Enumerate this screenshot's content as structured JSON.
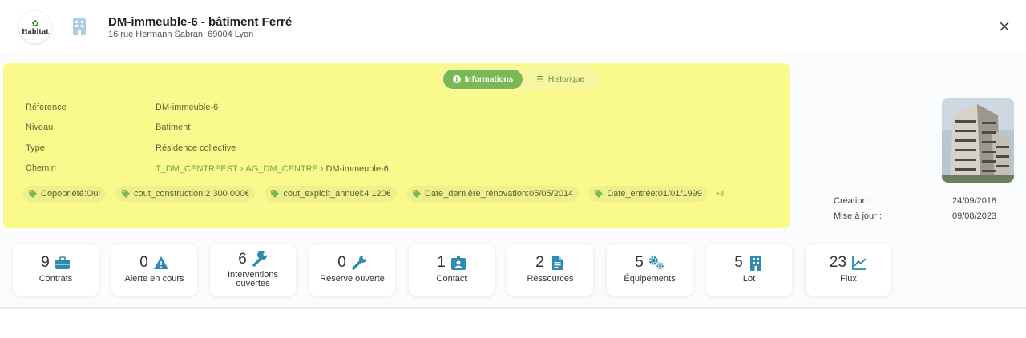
{
  "header": {
    "logo_text": "Habitat",
    "title": "DM-immeuble-6 - bâtiment Ferré",
    "address": "16 rue Hermann Sabran, 69004 Lyon"
  },
  "tabs": {
    "active_label": "Informations",
    "inactive_label": "Historique"
  },
  "info": {
    "reference_label": "Référence",
    "reference_value": "DM-immeuble-6",
    "niveau_label": "Niveau",
    "niveau_value": "Batiment",
    "type_label": "Type",
    "type_value": "Résidence collective",
    "chemin_label": "Chemin",
    "chemin": [
      "T_DM_CENTREEST",
      "AG_DM_CENTRE",
      "DM-immeuble-6"
    ]
  },
  "tags": [
    "Copopriété:Oui",
    "cout_construction:2 300 000€",
    "cout_exploit_annuel:4 120€",
    "Date_dernière_rénovation:05/05/2014",
    "Date_entrée:01/01/1999"
  ],
  "tags_more": "+8",
  "meta": {
    "creation_label": "Création :",
    "creation_value": "24/09/2018",
    "update_label": "Mise à jour :",
    "update_value": "09/08/2023"
  },
  "cards": [
    {
      "count": "9",
      "label": "Contrats",
      "icon": "toolbox-icon"
    },
    {
      "count": "0",
      "label": "Alerte en cours",
      "icon": "warning-icon"
    },
    {
      "count": "6",
      "label": "Interventions ouvertes",
      "icon": "wrench-icon"
    },
    {
      "count": "0",
      "label": "Réserve ouverte",
      "icon": "wrench-icon"
    },
    {
      "count": "1",
      "label": "Contact",
      "icon": "contact-card-icon"
    },
    {
      "count": "2",
      "label": "Ressources",
      "icon": "document-icon"
    },
    {
      "count": "5",
      "label": "Équipements",
      "icon": "gears-icon"
    },
    {
      "count": "5",
      "label": "Lot",
      "icon": "building-icon"
    },
    {
      "count": "23",
      "label": "Flux",
      "icon": "line-chart-icon"
    }
  ],
  "colors": {
    "accent": "#79b855",
    "highlight": "#fafa8c",
    "icon_blue": "#2f8bb0"
  }
}
